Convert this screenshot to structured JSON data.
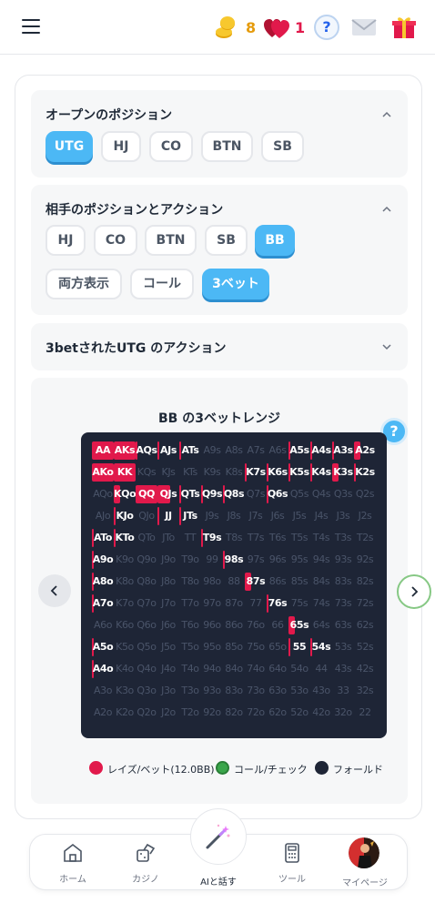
{
  "header": {
    "coins": "8",
    "hearts": "1",
    "help": "?"
  },
  "open_position": {
    "title": "オープンのポジション",
    "options": [
      "UTG",
      "HJ",
      "CO",
      "BTN",
      "SB"
    ],
    "selected": "UTG"
  },
  "opponent": {
    "title": "相手のポジションとアクション",
    "positions": [
      "HJ",
      "CO",
      "BTN",
      "SB",
      "BB"
    ],
    "selected_position": "BB",
    "actions": [
      "両方表示",
      "コール",
      "3ベット"
    ],
    "selected_action": "3ベット"
  },
  "collapsed": {
    "title": "3betされたUTG のアクション"
  },
  "range": {
    "title": "BB の3ベットレンジ",
    "help": "?",
    "hands": [
      [
        "AA",
        "AKs",
        "AQs",
        "AJs",
        "ATs",
        "A9s",
        "A8s",
        "A7s",
        "A6s",
        "A5s",
        "A4s",
        "A3s",
        "A2s"
      ],
      [
        "AKo",
        "KK",
        "KQs",
        "KJs",
        "KTs",
        "K9s",
        "K8s",
        "K7s",
        "K6s",
        "K5s",
        "K4s",
        "K3s",
        "K2s"
      ],
      [
        "AQo",
        "KQo",
        "QQ",
        "QJs",
        "QTs",
        "Q9s",
        "Q8s",
        "Q7s",
        "Q6s",
        "Q5s",
        "Q4s",
        "Q3s",
        "Q2s"
      ],
      [
        "AJo",
        "KJo",
        "QJo",
        "JJ",
        "JTs",
        "J9s",
        "J8s",
        "J7s",
        "J6s",
        "J5s",
        "J4s",
        "J3s",
        "J2s"
      ],
      [
        "ATo",
        "KTo",
        "QTo",
        "JTo",
        "TT",
        "T9s",
        "T8s",
        "T7s",
        "T6s",
        "T5s",
        "T4s",
        "T3s",
        "T2s"
      ],
      [
        "A9o",
        "K9o",
        "Q9o",
        "J9o",
        "T9o",
        "99",
        "98s",
        "97s",
        "96s",
        "95s",
        "94s",
        "93s",
        "92s"
      ],
      [
        "A8o",
        "K8o",
        "Q8o",
        "J8o",
        "T8o",
        "98o",
        "88",
        "87s",
        "86s",
        "85s",
        "84s",
        "83s",
        "82s"
      ],
      [
        "A7o",
        "K7o",
        "Q7o",
        "J7o",
        "T7o",
        "97o",
        "87o",
        "77",
        "76s",
        "75s",
        "74s",
        "73s",
        "72s"
      ],
      [
        "A6o",
        "K6o",
        "Q6o",
        "J6o",
        "T6o",
        "96o",
        "86o",
        "76o",
        "66",
        "65s",
        "64s",
        "63s",
        "62s"
      ],
      [
        "A5o",
        "K5o",
        "Q5o",
        "J5o",
        "T5o",
        "95o",
        "85o",
        "75o",
        "65o",
        "55",
        "54s",
        "53s",
        "52s"
      ],
      [
        "A4o",
        "K4o",
        "Q4o",
        "J4o",
        "T4o",
        "94o",
        "84o",
        "74o",
        "64o",
        "54o",
        "44",
        "43s",
        "42s"
      ],
      [
        "A3o",
        "K3o",
        "Q3o",
        "J3o",
        "T3o",
        "93o",
        "83o",
        "73o",
        "63o",
        "53o",
        "43o",
        "33",
        "32s"
      ],
      [
        "A2o",
        "K2o",
        "Q2o",
        "J2o",
        "T2o",
        "92o",
        "82o",
        "72o",
        "62o",
        "52o",
        "42o",
        "32o",
        "22"
      ]
    ],
    "raise_freq": [
      [
        1,
        1,
        0.1,
        0.1,
        0.1,
        0,
        0,
        0,
        0,
        0.1,
        0.1,
        0.1,
        0.3
      ],
      [
        1,
        1,
        0,
        0,
        0,
        0,
        0,
        0.1,
        0.1,
        0.1,
        0.1,
        0.3,
        0.1
      ],
      [
        0,
        0.3,
        1,
        0.6,
        0.1,
        0.1,
        0.1,
        0,
        0.1,
        0,
        0,
        0,
        0
      ],
      [
        0,
        0.1,
        0,
        0.1,
        0.1,
        0,
        0,
        0,
        0,
        0,
        0,
        0,
        0
      ],
      [
        0.1,
        0.1,
        0,
        0,
        0,
        0.1,
        0,
        0,
        0,
        0,
        0,
        0,
        0
      ],
      [
        0.1,
        0,
        0,
        0,
        0,
        0,
        0.1,
        0,
        0,
        0,
        0,
        0,
        0
      ],
      [
        0.1,
        0,
        0,
        0,
        0,
        0,
        0,
        0.3,
        0,
        0,
        0,
        0,
        0
      ],
      [
        0.1,
        0,
        0,
        0,
        0,
        0,
        0,
        0,
        0.1,
        0,
        0,
        0,
        0
      ],
      [
        0,
        0,
        0,
        0,
        0,
        0,
        0,
        0,
        0,
        0.3,
        0,
        0,
        0
      ],
      [
        0.1,
        0,
        0,
        0,
        0,
        0,
        0,
        0,
        0,
        0.1,
        0.1,
        0,
        0
      ],
      [
        0.1,
        0,
        0,
        0,
        0,
        0,
        0,
        0,
        0,
        0,
        0,
        0,
        0
      ],
      [
        0,
        0,
        0,
        0,
        0,
        0,
        0,
        0,
        0,
        0,
        0,
        0,
        0
      ],
      [
        0,
        0,
        0,
        0,
        0,
        0,
        0,
        0,
        0,
        0,
        0,
        0,
        0
      ]
    ]
  },
  "legend": {
    "raise": "レイズ/ベット(12.0BB)",
    "call": "コール/チェック",
    "fold": "フォールド",
    "raise_color": "#e1194b",
    "call_color": "#3aa64b",
    "fold_color": "#1e2536"
  },
  "nav": {
    "home": "ホーム",
    "casino": "カジノ",
    "ai": "AIと話す",
    "tools": "ツール",
    "mypage": "マイページ"
  }
}
